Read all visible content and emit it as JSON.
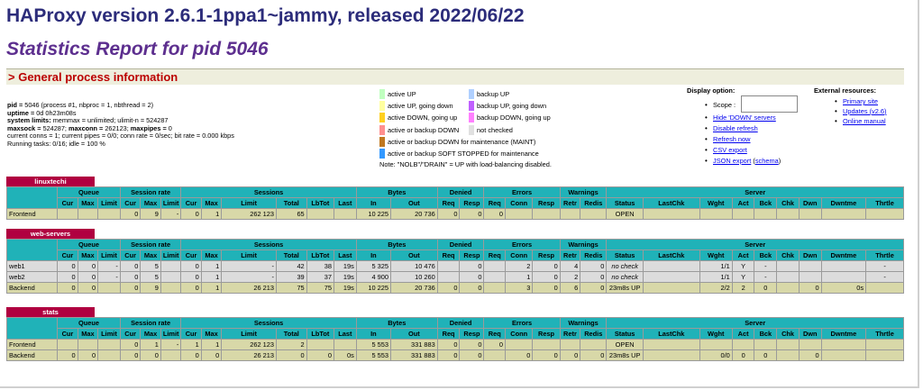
{
  "title": "HAProxy version 2.6.1-1ppa1~jammy, released 2022/06/22",
  "subtitle": "Statistics Report for pid 5046",
  "section_title": "> General process information",
  "info": {
    "pid_label": "pid =",
    "pid_value": "5046 (process #1, nbproc = 1, nbthread = 2)",
    "uptime_label": "uptime =",
    "uptime_value": "0d 0h23m08s",
    "limits_label": "system limits:",
    "limits_value": "memmax = unlimited; ulimit-n = 524287",
    "maxsock_label": "maxsock =",
    "maxsock_value": "524287;",
    "maxconn_label": "maxconn =",
    "maxconn_value": "262123;",
    "maxpipes_label": "maxpipes =",
    "maxpipes_value": "0",
    "conns_line": "current conns = 1; current pipes = 0/0; conn rate = 0/sec; bit rate = 0.000 kbps",
    "tasks_line": "Running tasks: 0/16; idle = 100 %"
  },
  "legend": {
    "items_left": [
      {
        "label": "active UP",
        "color": "#c0ffc0"
      },
      {
        "label": "active UP, going down",
        "color": "#ffffa0"
      },
      {
        "label": "active DOWN, going up",
        "color": "#ffd020"
      },
      {
        "label": "active or backup DOWN",
        "color": "#ff9090"
      },
      {
        "label": "active or backup DOWN for maintenance (MAINT)",
        "color": "#c07820"
      },
      {
        "label": "active or backup SOFT STOPPED for maintenance",
        "color": "#3399ff"
      }
    ],
    "items_right": [
      {
        "label": "backup UP",
        "color": "#b0d0ff"
      },
      {
        "label": "backup UP, going down",
        "color": "#c060ff"
      },
      {
        "label": "backup DOWN, going up",
        "color": "#ff80ff"
      },
      {
        "label": "not checked",
        "color": "#e0e0e0"
      }
    ],
    "note": "Note: \"NOLB\"/\"DRAIN\" = UP with load-balancing disabled."
  },
  "display": {
    "title": "Display option:",
    "scope_label": "Scope :",
    "links": [
      "Hide 'DOWN' servers",
      "Disable refresh",
      "Refresh now",
      "CSV export"
    ],
    "json_link": "JSON export",
    "schema_link": "schema"
  },
  "external": {
    "title": "External resources:",
    "primary": "Primary site",
    "updates": "Updates",
    "updates_ver": "v2.6",
    "manual": "Online manual"
  },
  "headers": {
    "groups": [
      "Queue",
      "Session rate",
      "Sessions",
      "Bytes",
      "Denied",
      "Errors",
      "Warnings",
      "Server"
    ],
    "cols": [
      "Cur",
      "Max",
      "Limit",
      "Cur",
      "Max",
      "Limit",
      "Cur",
      "Max",
      "Limit",
      "Total",
      "LbTot",
      "Last",
      "In",
      "Out",
      "Req",
      "Resp",
      "Req",
      "Conn",
      "Resp",
      "Retr",
      "Redis",
      "Status",
      "LastChk",
      "Wght",
      "Act",
      "Bck",
      "Chk",
      "Dwn",
      "Dwntme",
      "Thrtle"
    ]
  },
  "proxies": [
    {
      "name": "linuxtechi",
      "rows": [
        {
          "type": "fr",
          "cells": [
            "Frontend",
            "",
            "",
            "",
            "0",
            "9",
            "-",
            "0",
            "1",
            "262 123",
            "65",
            "",
            "",
            "10 225",
            "20 736",
            "0",
            "0",
            "0",
            "",
            "",
            "",
            "",
            "OPEN",
            "",
            "",
            "",
            "",
            "",
            "",
            "",
            ""
          ]
        }
      ]
    },
    {
      "name": "web-servers",
      "rows": [
        {
          "type": "sv",
          "cells": [
            "web1",
            "0",
            "0",
            "-",
            "0",
            "5",
            "",
            "0",
            "1",
            "-",
            "42",
            "38",
            "19s",
            "5 325",
            "10 476",
            "",
            "0",
            "",
            "2",
            "0",
            "4",
            "0",
            "no check",
            "",
            "1/1",
            "Y",
            "-",
            "",
            "",
            "",
            "-"
          ]
        },
        {
          "type": "sv",
          "cells": [
            "web2",
            "0",
            "0",
            "-",
            "0",
            "5",
            "",
            "0",
            "1",
            "-",
            "39",
            "37",
            "19s",
            "4 900",
            "10 260",
            "",
            "0",
            "",
            "1",
            "0",
            "2",
            "0",
            "no check",
            "",
            "1/1",
            "Y",
            "-",
            "",
            "",
            "",
            "-"
          ]
        },
        {
          "type": "bk",
          "cells": [
            "Backend",
            "0",
            "0",
            "",
            "0",
            "9",
            "",
            "0",
            "1",
            "26 213",
            "75",
            "75",
            "19s",
            "10 225",
            "20 736",
            "0",
            "0",
            "",
            "3",
            "0",
            "6",
            "0",
            "23m8s UP",
            "",
            "2/2",
            "2",
            "0",
            "",
            "0",
            "0s",
            ""
          ]
        }
      ]
    },
    {
      "name": "stats",
      "rows": [
        {
          "type": "fr",
          "cells": [
            "Frontend",
            "",
            "",
            "",
            "0",
            "1",
            "-",
            "1",
            "1",
            "262 123",
            "2",
            "",
            "",
            "5 553",
            "331 883",
            "0",
            "0",
            "0",
            "",
            "",
            "",
            "",
            "OPEN",
            "",
            "",
            "",
            "",
            "",
            "",
            "",
            ""
          ]
        },
        {
          "type": "bk",
          "cells": [
            "Backend",
            "0",
            "0",
            "",
            "0",
            "0",
            "",
            "0",
            "0",
            "26 213",
            "0",
            "0",
            "0s",
            "5 553",
            "331 883",
            "0",
            "0",
            "",
            "0",
            "0",
            "0",
            "0",
            "23m8s UP",
            "",
            "0/0",
            "0",
            "0",
            "",
            "0",
            "",
            ""
          ]
        }
      ]
    }
  ]
}
